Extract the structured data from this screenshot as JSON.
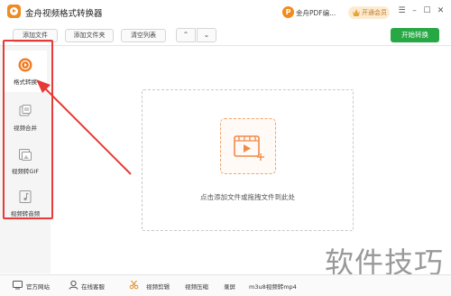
{
  "window": {
    "title": "金舟视频格式转换器",
    "pdf_label": "金舟PDF编...",
    "vip_label": "开通会员",
    "minimize": "–",
    "restore": "☐",
    "close": "✕",
    "menu": "☰"
  },
  "toolbar": {
    "add_file": "添加文件",
    "add_folder": "添加文件夹",
    "clear_list": "清空列表",
    "move_up": "⌃",
    "move_down": "⌄",
    "start": "开始转换"
  },
  "sidebar": {
    "items": [
      {
        "label": "格式转换",
        "icon": "format-convert-icon",
        "active": true
      },
      {
        "label": "视频合并",
        "icon": "merge-icon",
        "active": false
      },
      {
        "label": "视频转GIF",
        "icon": "gif-icon",
        "active": false
      },
      {
        "label": "视频转音频",
        "icon": "audio-icon",
        "active": false
      }
    ]
  },
  "main": {
    "drop_hint": "点击添加文件或拖拽文件到此处"
  },
  "bottom": {
    "website": "官方网站",
    "support": "在线客服",
    "clip": "视频剪辑",
    "compress": "视频压缩",
    "record": "录屏",
    "m3u8": "m3u8视频转mp4"
  },
  "watermark": "软件技巧",
  "colors": {
    "accent_green": "#27a844",
    "annotation_red": "#e53a35",
    "brand_orange": "#f08a24"
  }
}
